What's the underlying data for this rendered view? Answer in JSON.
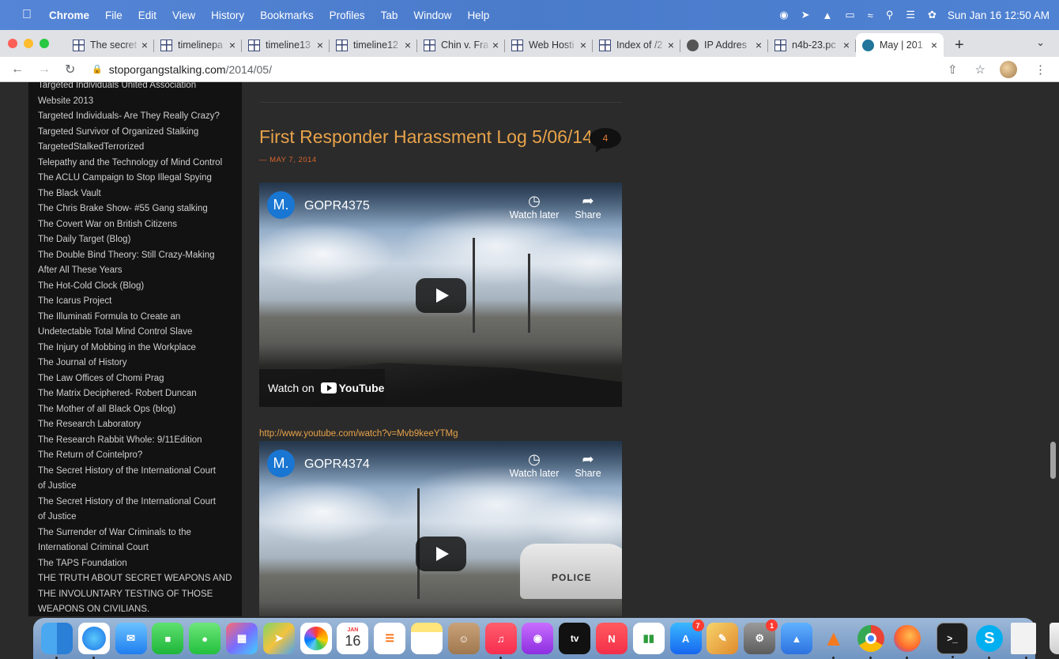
{
  "menubar": {
    "app": "Chrome",
    "items": [
      "File",
      "Edit",
      "View",
      "History",
      "Bookmarks",
      "Profiles",
      "Tab",
      "Window",
      "Help"
    ],
    "clock": "Sun Jan 16  12:50 AM"
  },
  "tabs": [
    {
      "title": "The secret",
      "icon": "grid-icon"
    },
    {
      "title": "timelinepa",
      "icon": "grid-icon"
    },
    {
      "title": "timeline13",
      "icon": "grid-icon"
    },
    {
      "title": "timeline12",
      "icon": "grid-icon"
    },
    {
      "title": "Chin v. Fra",
      "icon": "grid-icon"
    },
    {
      "title": "Web Hosti",
      "icon": "grid-icon"
    },
    {
      "title": "Index of /2",
      "icon": "grid-icon"
    },
    {
      "title": "IP Addres",
      "icon": "globe-icon"
    },
    {
      "title": "n4b-23.pc",
      "icon": "grid-icon"
    },
    {
      "title": "May | 201",
      "icon": "wordpress-icon",
      "active": true
    }
  ],
  "address": {
    "domain": "stoporgangstalking.com",
    "path": "/2014/05/"
  },
  "sidebar": {
    "links": [
      "Targeted Individuals United Association",
      "Website 2013",
      "Targeted Individuals- Are They Really Crazy?",
      "Targeted Survivor of Organized Stalking",
      "TargetedStalkedTerrorized",
      "Telepathy and the Technology of Mind Control",
      "The ACLU Campaign to Stop Illegal Spying",
      "The Black Vault",
      "The Chris Brake Show- #55 Gang stalking",
      "The Covert War on British Citizens",
      "The Daily Target (Blog)",
      "The Double Bind Theory: Still Crazy-Making",
      "After All These Years",
      "The Hot-Cold Clock (Blog)",
      "The Icarus Project",
      "The Illuminati Formula to Create an",
      "Undetectable Total Mind Control Slave",
      "The Injury of Mobbing in the Workplace",
      "The Journal of History",
      "The Law Offices of Chomi Prag",
      "The Matrix Deciphered- Robert Duncan",
      "The Mother of all Black Ops (blog)",
      "The Research Laboratory",
      "The Research Rabbit Whole: 9/11Edition",
      "The Return of Cointelpro?",
      "The Secret History of the International Court",
      "of Justice",
      "The Secret History of the International Court",
      "of Justice",
      "The Surrender of War Criminals to the",
      "International Criminal Court",
      "The TAPS Foundation",
      "THE TRUTH ABOUT SECRET WEAPONS AND",
      "THE INVOLUNTARY TESTING OF THOSE",
      "WEAPONS ON CIVILIANS."
    ]
  },
  "post": {
    "title": "First Responder Harassment Log 5/06/14",
    "comment_count": "4",
    "date": "— MAY 7, 2014",
    "link": "http://www.youtube.com/watch?v=Mvb9keeYTMg"
  },
  "videos": [
    {
      "channel_initial": "M.",
      "title": "GOPR4375",
      "watch_later": "Watch later",
      "share": "Share",
      "watch_on": "Watch on",
      "yt": "YouTube"
    },
    {
      "channel_initial": "M.",
      "title": "GOPR4374",
      "watch_later": "Watch later",
      "share": "Share",
      "police": "POLICE"
    }
  ],
  "dock": {
    "calendar_month": "JAN",
    "calendar_day": "16",
    "tv_label": "tv",
    "appstore_badge": "7",
    "settings_badge": "1"
  },
  "colors": {
    "accent_orange": "#e8a34a",
    "date_orange": "#d9652c",
    "sidebar_bg": "#121212",
    "page_bg": "#2b2b2b"
  }
}
